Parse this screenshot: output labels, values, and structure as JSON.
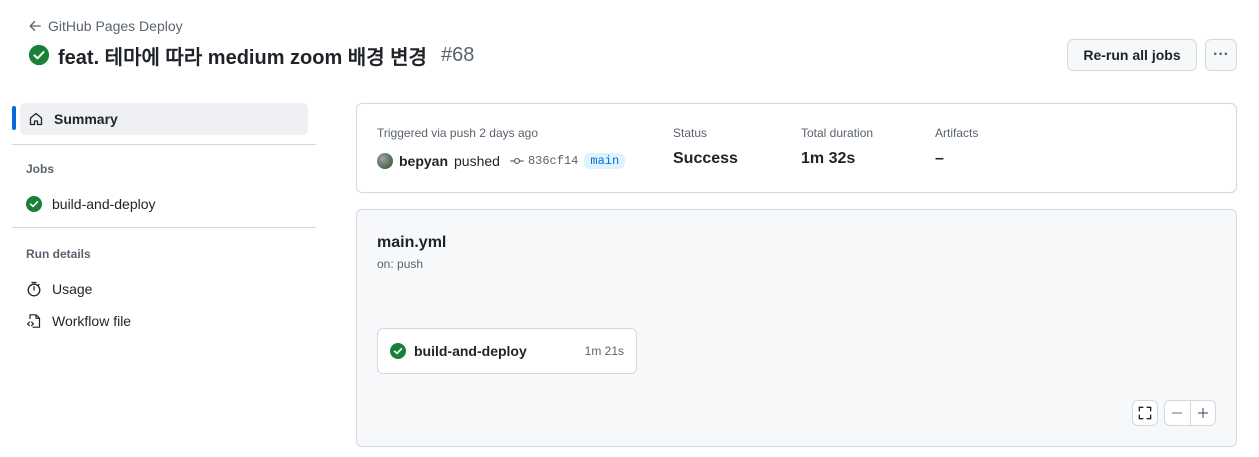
{
  "header": {
    "back_label": "GitHub Pages Deploy",
    "title": "feat. 테마에 따라 medium zoom 배경 변경",
    "run_number": "#68",
    "rerun_label": "Re-run all jobs",
    "more_label": "···"
  },
  "sidebar": {
    "summary_label": "Summary",
    "jobs_heading": "Jobs",
    "jobs": [
      {
        "label": "build-and-deploy"
      }
    ],
    "run_details_heading": "Run details",
    "usage_label": "Usage",
    "workflow_file_label": "Workflow file"
  },
  "summary": {
    "trigger_label": "Triggered via push 2 days ago",
    "actor": "bepyan",
    "action": "pushed",
    "commit": "836cf14",
    "branch": "main",
    "status_label": "Status",
    "status_value": "Success",
    "duration_label": "Total duration",
    "duration_value": "1m 32s",
    "artifacts_label": "Artifacts",
    "artifacts_value": "–"
  },
  "workflow": {
    "file": "main.yml",
    "trigger": "on: push",
    "job": {
      "name": "build-and-deploy",
      "duration": "1m 21s"
    }
  },
  "colors": {
    "success": "#1a7f37",
    "accent": "#0969da",
    "muted": "#59636e"
  },
  "icons": [
    "arrow-left-icon",
    "check-circle-icon",
    "home-icon",
    "stopwatch-icon",
    "file-code-icon",
    "commit-icon",
    "fullscreen-icon",
    "minus-icon",
    "plus-icon"
  ]
}
